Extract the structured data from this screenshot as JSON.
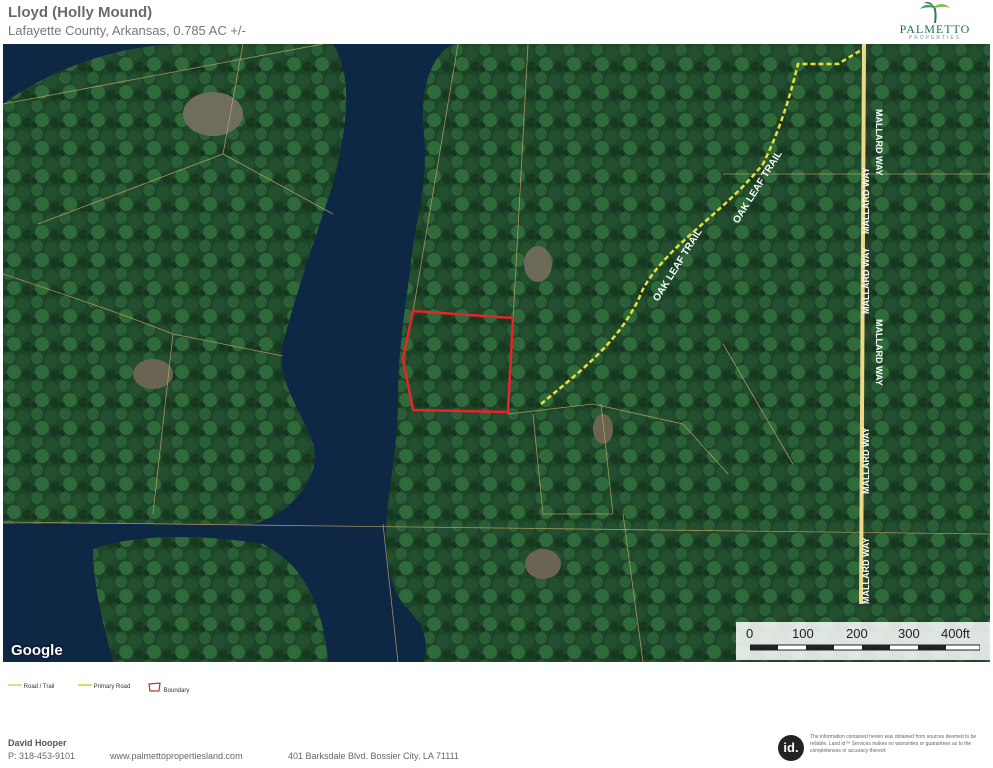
{
  "header": {
    "title": "Lloyd (Holly Mound)",
    "subtitle": "Lafayette County, Arkansas, 0.785 AC +/-"
  },
  "logo": {
    "name": "PALMETTO",
    "tagline": "PROPERTIES"
  },
  "map": {
    "provider": "Google",
    "road_labels": {
      "oak_leaf_trail": "OAK LEAF TRAIL",
      "mallard_way": "MALLARD WAY"
    },
    "scale": {
      "ticks": [
        "0",
        "100",
        "200",
        "300",
        "400ft"
      ]
    },
    "colors": {
      "boundary": "#e8232a",
      "primary_road": "#e9e03a",
      "road_trail": "#f2e28a",
      "water": "#0d2744",
      "forest": "#1f4a2c"
    }
  },
  "legend": {
    "items": [
      {
        "label": "Road / Trail",
        "icon": "line-icon"
      },
      {
        "label": "Primary Road",
        "icon": "line-icon"
      },
      {
        "label": "Boundary",
        "icon": "polygon-icon"
      }
    ]
  },
  "footer": {
    "agent_name": "David Hooper",
    "phone": "P: 318-453-9101",
    "website": "www.palmettopropertiesland.com",
    "address": "401 Barksdale Blvd. Bossier City, LA 71111",
    "badge": "id.",
    "disclaimer": "The information contained herein was obtained from sources deemed to be reliable. Land id™ Services makes no warranties or guarantees as to the completeness or accuracy thereof."
  }
}
